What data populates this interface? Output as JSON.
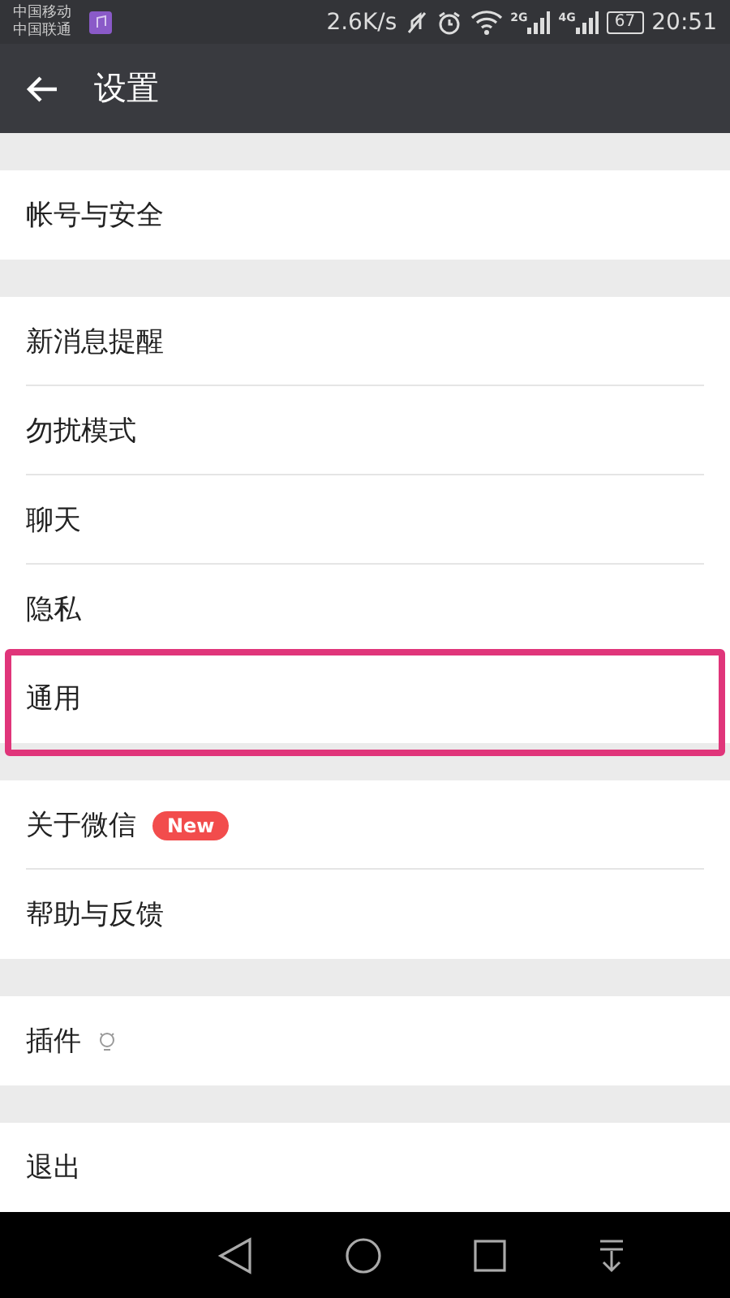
{
  "status_bar": {
    "carriers": [
      "中国移动",
      "中国联通"
    ],
    "speed": "2.6K/s",
    "signals": [
      "2G",
      "4G"
    ],
    "battery": "67",
    "time": "20:51"
  },
  "header": {
    "title": "设置"
  },
  "groups": [
    {
      "items": [
        {
          "label": "帐号与安全",
          "highlighted": false
        }
      ]
    },
    {
      "items": [
        {
          "label": "新消息提醒",
          "highlighted": false
        },
        {
          "label": "勿扰模式",
          "highlighted": false
        },
        {
          "label": "聊天",
          "highlighted": false
        },
        {
          "label": "隐私",
          "highlighted": false
        },
        {
          "label": "通用",
          "highlighted": true
        }
      ]
    },
    {
      "items": [
        {
          "label": "关于微信",
          "highlighted": false,
          "badge": "New"
        },
        {
          "label": "帮助与反馈",
          "highlighted": false
        }
      ]
    },
    {
      "items": [
        {
          "label": "插件",
          "highlighted": false,
          "kind": "tip"
        }
      ]
    },
    {
      "items": [
        {
          "label": "退出",
          "highlighted": false
        }
      ]
    }
  ]
}
